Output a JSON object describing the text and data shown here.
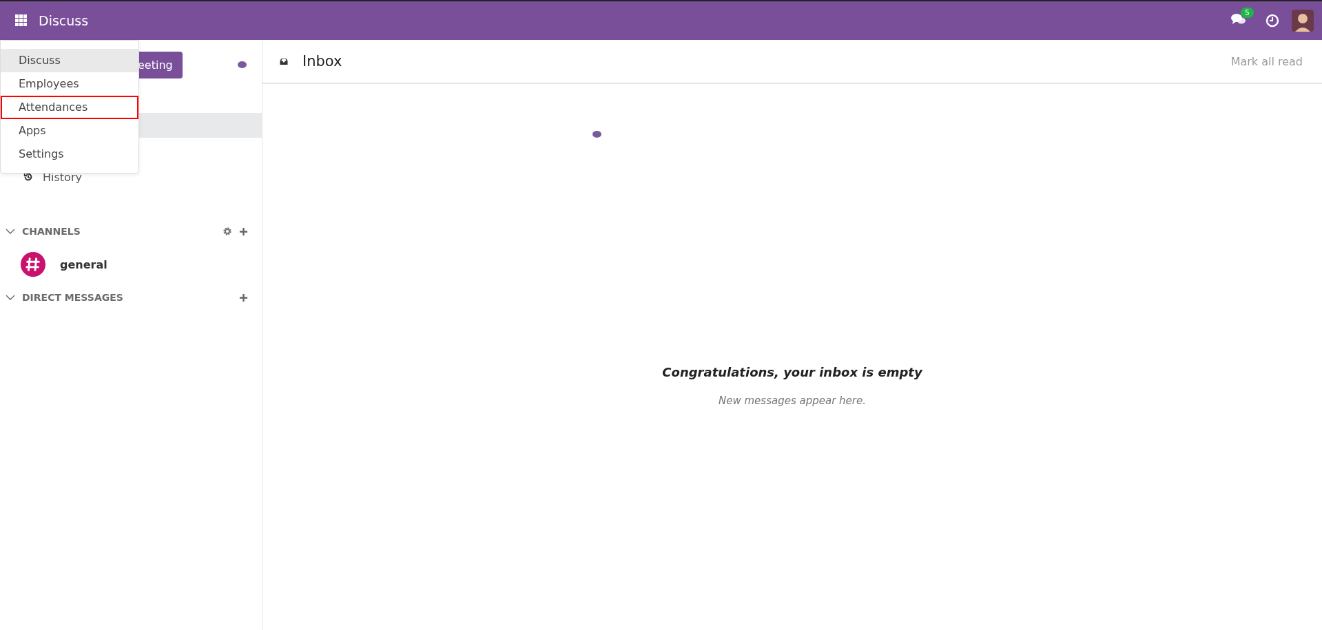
{
  "navbar": {
    "app_title": "Discuss",
    "chat_badge": "5"
  },
  "app_menu": {
    "items": [
      {
        "label": "Discuss",
        "selected": true,
        "highlighted": false
      },
      {
        "label": "Employees",
        "selected": false,
        "highlighted": false
      },
      {
        "label": "Attendances",
        "selected": false,
        "highlighted": true
      },
      {
        "label": "Apps",
        "selected": false,
        "highlighted": false
      },
      {
        "label": "Settings",
        "selected": false,
        "highlighted": false
      }
    ]
  },
  "sidebar": {
    "meeting_button": "eeting",
    "history": "History",
    "sections": [
      {
        "title": "CHANNELS",
        "settings": true,
        "channels": [
          {
            "name": "general",
            "color": "#c8126e"
          }
        ]
      },
      {
        "title": "DIRECT MESSAGES",
        "settings": false
      }
    ]
  },
  "main": {
    "title": "Inbox",
    "mark_all_read": "Mark all read",
    "empty_title": "Congratulations, your inbox is empty",
    "empty_subtitle": "New messages appear here."
  }
}
